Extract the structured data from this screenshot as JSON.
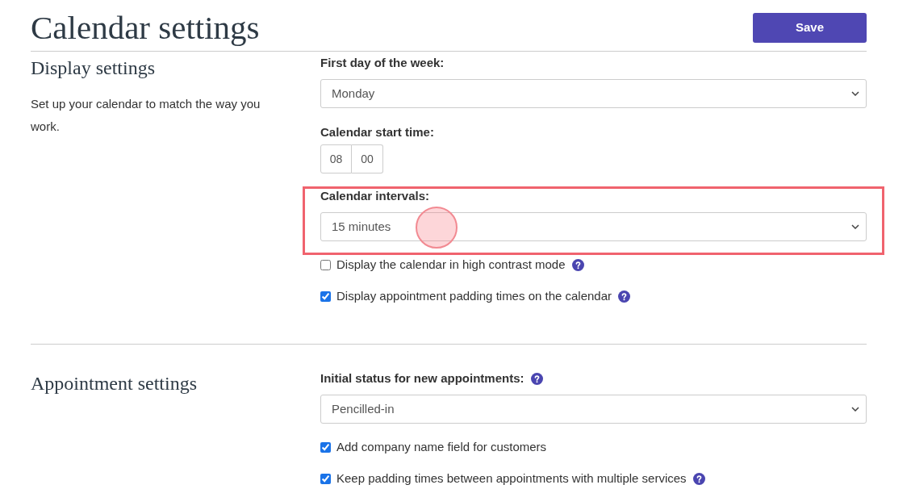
{
  "page_title": "Calendar settings",
  "save_button": "Save",
  "sections": [
    {
      "title": "Display settings",
      "description": "Set up your calendar to match the way you work.",
      "fields": [
        {
          "kind": "select",
          "label": "First day of the week:",
          "value": "Monday",
          "help": false,
          "highlighted": false
        },
        {
          "kind": "time",
          "label": "Calendar start time:",
          "hours": "08",
          "minutes": "00",
          "help": false,
          "highlighted": false
        },
        {
          "kind": "select",
          "label": "Calendar intervals:",
          "value": "15 minutes",
          "help": false,
          "highlighted": true
        },
        {
          "kind": "checkbox",
          "label": "Display the calendar in high contrast mode",
          "checked": false,
          "help": true
        },
        {
          "kind": "checkbox",
          "label": "Display appointment padding times on the calendar",
          "checked": true,
          "help": true
        }
      ]
    },
    {
      "title": "Appointment settings",
      "fields": [
        {
          "kind": "select",
          "label": "Initial status for new appointments:",
          "value": "Pencilled-in",
          "help": true,
          "highlighted": false
        },
        {
          "kind": "checkbox",
          "label": "Add company name field for customers",
          "checked": true,
          "help": false
        },
        {
          "kind": "checkbox",
          "label": "Keep padding times between appointments with multiple services",
          "checked": true,
          "help": true
        }
      ]
    }
  ]
}
